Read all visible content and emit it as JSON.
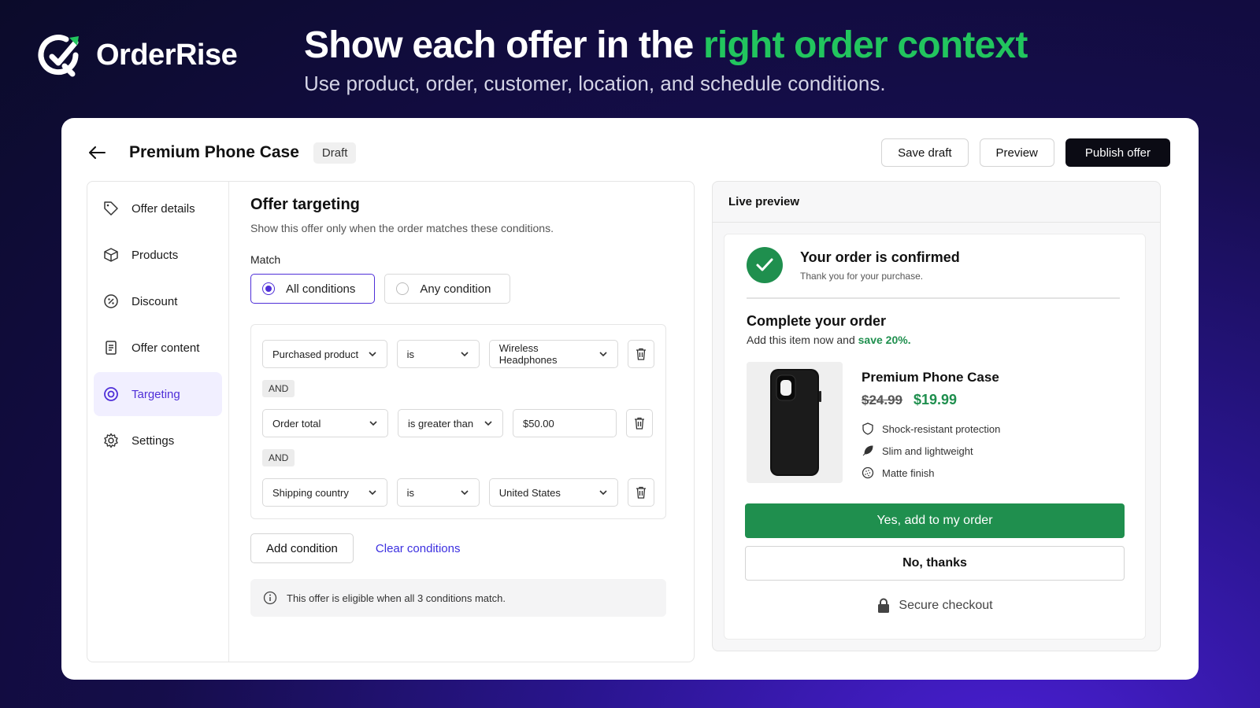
{
  "brand": {
    "name": "OrderRise",
    "accent": "#22c55e",
    "primary": "#4f2fd8"
  },
  "hero": {
    "title_plain": "Show each offer in the ",
    "title_accent": "right order context",
    "subtitle": "Use product, order, customer, location, and schedule conditions."
  },
  "header": {
    "title": "Premium Phone Case",
    "status": "Draft",
    "save_draft": "Save draft",
    "preview": "Preview",
    "publish": "Publish offer"
  },
  "sidebar": {
    "items": [
      {
        "label": "Offer details",
        "icon": "tag-icon"
      },
      {
        "label": "Products",
        "icon": "box-icon"
      },
      {
        "label": "Discount",
        "icon": "discount-icon"
      },
      {
        "label": "Offer content",
        "icon": "document-icon"
      },
      {
        "label": "Targeting",
        "icon": "target-icon",
        "active": true
      },
      {
        "label": "Settings",
        "icon": "gear-icon"
      }
    ]
  },
  "targeting": {
    "title": "Offer targeting",
    "description": "Show this offer only when the order matches these conditions.",
    "match_label": "Match",
    "match_all": "All conditions",
    "match_any": "Any condition",
    "selected": "All conditions",
    "connector": "AND",
    "conditions": [
      {
        "field": "Purchased product",
        "operator": "is",
        "value": "Wireless Headphones"
      },
      {
        "field": "Order total",
        "operator": "is greater than",
        "value": "$50.00"
      },
      {
        "field": "Shipping country",
        "operator": "is",
        "value": "United States"
      }
    ],
    "add_condition": "Add condition",
    "clear_conditions": "Clear conditions",
    "info": "This offer is eligible when all 3 conditions match."
  },
  "preview": {
    "header": "Live preview",
    "confirm_title": "Your order is confirmed",
    "confirm_sub": "Thank you for your purchase.",
    "complete_title": "Complete your order",
    "complete_sub": "Add this item now and ",
    "save_text": "save 20%.",
    "product_name": "Premium Phone Case",
    "old_price": "$24.99",
    "new_price": "$19.99",
    "features": [
      {
        "label": "Shock-resistant protection",
        "icon": "shield-icon"
      },
      {
        "label": "Slim and lightweight",
        "icon": "feather-icon"
      },
      {
        "label": "Matte finish",
        "icon": "matte-icon"
      }
    ],
    "accept": "Yes, add to my order",
    "decline": "No, thanks",
    "secure": "Secure checkout"
  }
}
